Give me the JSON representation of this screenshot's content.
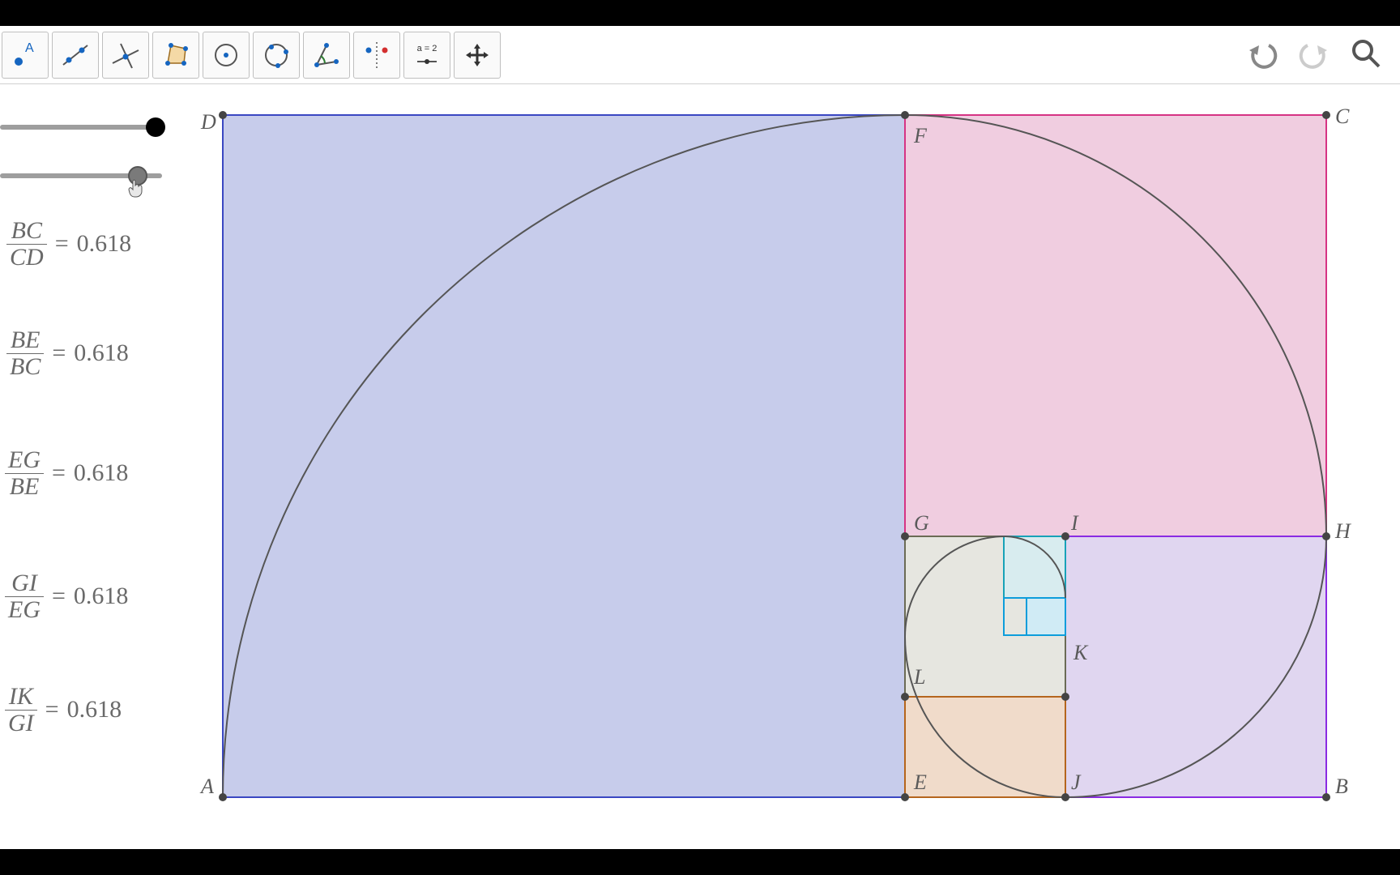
{
  "toolbar": {
    "tools": [
      {
        "name": "point-tool",
        "label": "A"
      },
      {
        "name": "line-tool"
      },
      {
        "name": "perpendicular-tool"
      },
      {
        "name": "polygon-tool"
      },
      {
        "name": "circle-center-tool"
      },
      {
        "name": "conic-tool"
      },
      {
        "name": "angle-tool"
      },
      {
        "name": "reflect-tool"
      },
      {
        "name": "slider-tool",
        "text": "a = 2"
      },
      {
        "name": "move-graphics-tool"
      }
    ],
    "right": {
      "undo": "Undo",
      "redo": "Redo",
      "search": "Search"
    }
  },
  "sliders": [
    {
      "name": "slider-1",
      "thumb_pct": 95
    },
    {
      "name": "slider-2",
      "thumb_pct": 82
    }
  ],
  "ratios": [
    {
      "num": "BC",
      "den": "CD",
      "val": "0.618"
    },
    {
      "num": "BE",
      "den": "BC",
      "val": "0.618"
    },
    {
      "num": "EG",
      "den": "BE",
      "val": "0.618"
    },
    {
      "num": "GI",
      "den": "EG",
      "val": "0.618"
    },
    {
      "num": "IK",
      "den": "GI",
      "val": "0.618"
    }
  ],
  "points": {
    "A": "A",
    "B": "B",
    "C": "C",
    "D": "D",
    "E": "E",
    "F": "F",
    "G": "G",
    "H": "H",
    "I": "I",
    "J": "J",
    "K": "K",
    "L": "L"
  },
  "colors": {
    "sq1_fill": "#c7cceb",
    "sq1_stroke": "#3a47c2",
    "sq2_fill": "#f0cde0",
    "sq2_stroke": "#d63384",
    "sq3_fill": "#e0d6f0",
    "sq3_stroke": "#8a2be2",
    "sq4_fill": "#e6e6e0",
    "sq4_stroke": "#6b6b55",
    "sq5_fill": "#f0dbca",
    "sq5_stroke": "#b5651d",
    "sq6_fill": "#d8ecef",
    "sq6_stroke": "#17a2b8",
    "sq7_fill": "#d0ebf5",
    "sq7_stroke": "#0d9ddb",
    "spiral": "#555555"
  }
}
